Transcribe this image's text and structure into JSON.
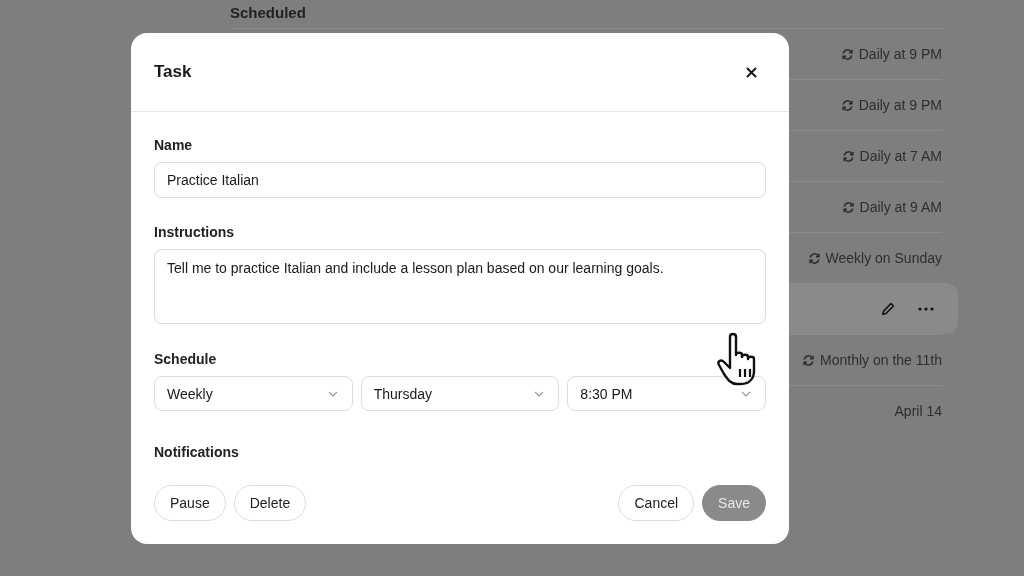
{
  "background": {
    "heading": "Scheduled",
    "rows": [
      {
        "schedule": "Daily at 9 PM",
        "repeating": true,
        "hovered": false
      },
      {
        "schedule": "Daily at 9 PM",
        "repeating": true,
        "hovered": false
      },
      {
        "schedule": "Daily at 7 AM",
        "repeating": true,
        "hovered": false
      },
      {
        "schedule": "Daily at 9 AM",
        "repeating": true,
        "hovered": false
      },
      {
        "schedule": "Weekly on Sunday",
        "repeating": true,
        "hovered": false
      },
      {
        "repeating": false,
        "hovered": true
      },
      {
        "schedule": "Monthly on the 11th",
        "repeating": true,
        "hovered": false
      },
      {
        "schedule": "April 14",
        "repeating": false,
        "hovered": false
      }
    ]
  },
  "dialog": {
    "title": "Task",
    "fields": [
      {
        "label": "Name",
        "kind": "input",
        "value": "Practice Italian"
      },
      {
        "label": "Instructions",
        "kind": "textarea",
        "value": "Tell me to practice Italian and include a lesson plan based on our learning goals."
      }
    ],
    "schedule": {
      "label": "Schedule",
      "selects": [
        {
          "value": "Weekly"
        },
        {
          "value": "Thursday"
        },
        {
          "value": "8:30 PM"
        }
      ]
    },
    "notifications": {
      "label": "Notifications"
    },
    "left_buttons": [
      {
        "label": "Pause",
        "disabled": false
      },
      {
        "label": "Delete",
        "disabled": false
      }
    ],
    "right_buttons": [
      {
        "label": "Cancel",
        "kind": "secondary",
        "disabled": false
      },
      {
        "label": "Save",
        "kind": "primary",
        "disabled": true
      }
    ]
  }
}
